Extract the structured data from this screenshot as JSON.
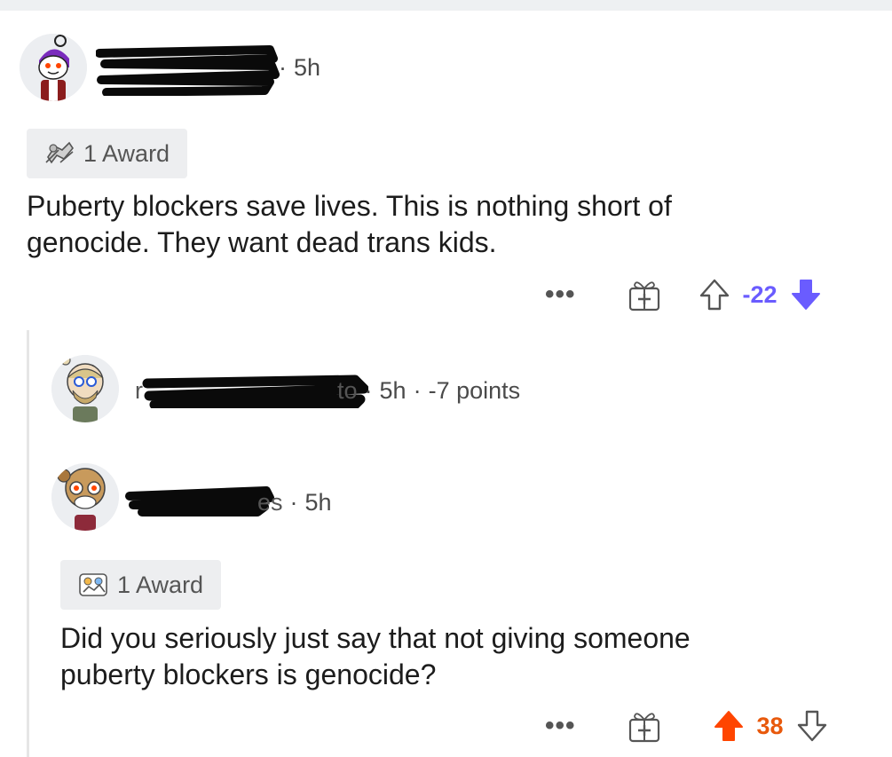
{
  "comments": [
    {
      "time": "5h",
      "award_label": "1 Award",
      "body_line1": "Puberty blockers save lives. This is nothing short of",
      "body_line2": "genocide. They want dead trans kids.",
      "more_label": "•••",
      "score": "-22",
      "vote_state": "downvoted",
      "score_color": "#6a5cff"
    },
    {
      "username_fragment_start": "r",
      "username_fragment_end": "to",
      "time": "5h",
      "points": "-7 points",
      "collapsed": true
    },
    {
      "username_fragment_end": "es",
      "time": "5h",
      "award_label": "1 Award",
      "body_line1": "Did you seriously just say that not giving someone",
      "body_line2": "puberty blockers is genocide?",
      "more_label": "•••",
      "score": "38",
      "vote_state": "upvoted",
      "score_color": "#e8590c"
    }
  ],
  "separator": "·",
  "icons": {
    "award": "award-icon",
    "gift": "gift-icon",
    "upvote": "upvote-arrow-icon",
    "downvote": "downvote-arrow-icon"
  }
}
